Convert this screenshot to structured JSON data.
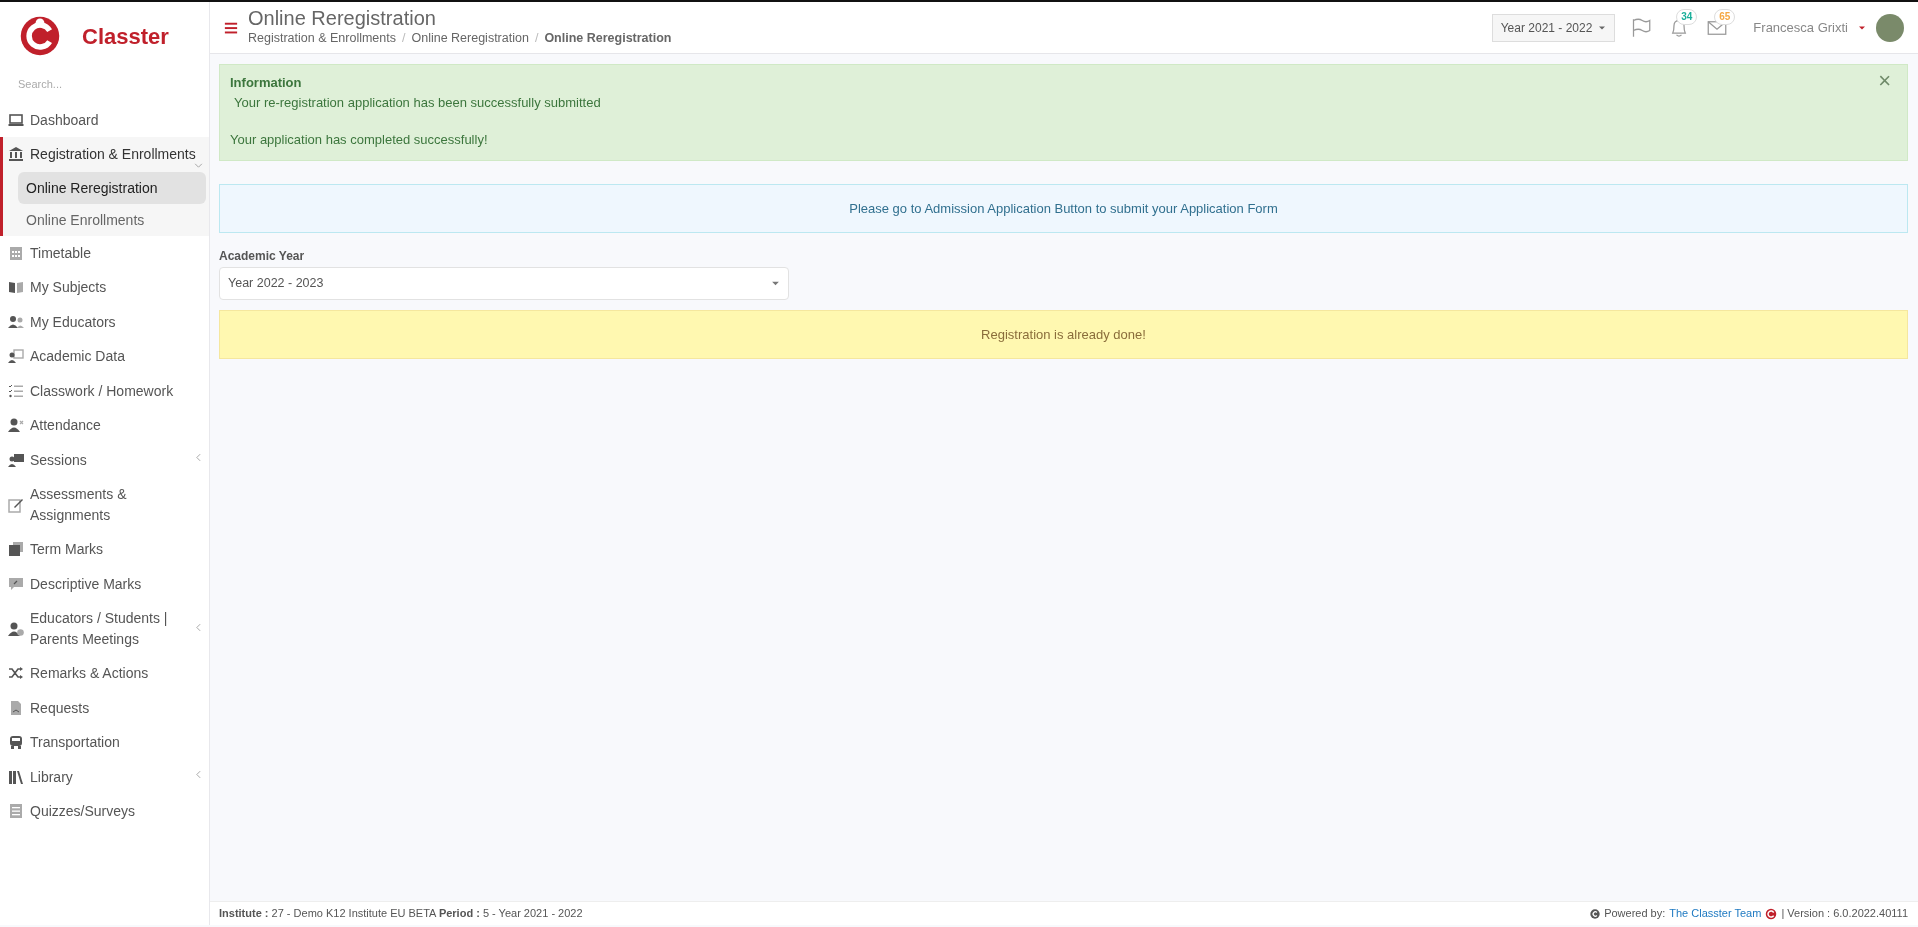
{
  "brand": {
    "name": "Classter"
  },
  "search": {
    "placeholder": "Search..."
  },
  "sidebar": {
    "items": [
      {
        "label": "Dashboard",
        "selected": false
      },
      {
        "label": "Registration & Enrollments",
        "selected": true,
        "expanded": true,
        "children": [
          {
            "label": "Online Reregistration",
            "selected": true
          },
          {
            "label": "Online Enrollments",
            "selected": false
          }
        ]
      },
      {
        "label": "Timetable",
        "selected": false
      },
      {
        "label": "My Subjects",
        "selected": false
      },
      {
        "label": "My Educators",
        "selected": false
      },
      {
        "label": "Academic Data",
        "selected": false
      },
      {
        "label": "Classwork / Homework",
        "selected": false
      },
      {
        "label": "Attendance",
        "selected": false
      },
      {
        "label": "Sessions",
        "selected": false,
        "expanded": false
      },
      {
        "label": "Assessments & Assignments",
        "selected": false
      },
      {
        "label": "Term Marks",
        "selected": false
      },
      {
        "label": "Descriptive Marks",
        "selected": false
      },
      {
        "label": "Educators / Students | Parents Meetings",
        "selected": false,
        "expanded": false
      },
      {
        "label": "Remarks & Actions",
        "selected": false
      },
      {
        "label": "Requests",
        "selected": false
      },
      {
        "label": "Transportation",
        "selected": false
      },
      {
        "label": "Library",
        "selected": false,
        "expanded": false
      },
      {
        "label": "Quizzes/Surveys",
        "selected": false
      }
    ]
  },
  "header": {
    "title": "Online Reregistration",
    "breadcrumb_separator": "/",
    "breadcrumb": [
      "Registration & Enrollments",
      "Online Reregistration",
      "Online Reregistration"
    ],
    "year_selector": "Year 2021 - 2022",
    "notifications": [
      {
        "count": "34",
        "color": "#1aaf9a"
      },
      {
        "count": "65",
        "color": "#f5a742"
      }
    ],
    "user": "Francesca Grixti"
  },
  "success_alert": {
    "title": "Information",
    "lines": [
      "Your re-registration application has been successfully submitted",
      "Your application has completed successfully!"
    ],
    "close": "×"
  },
  "info_alert": "Please go to Admission Application Button to submit your Application Form",
  "academic_year": {
    "label": "Academic Year",
    "value": "Year 2022 - 2023"
  },
  "warning_alert": "Registration is already done!",
  "footer": {
    "left": "**Institute :** 27 - Demo K12 Institute EU BETA **Period :** 5 - Year 2021 - 2022",
    "powered_by": "Powered by:",
    "team_link": "The Classter Team",
    "version": "| Version : 6.0.2022.40111"
  }
}
